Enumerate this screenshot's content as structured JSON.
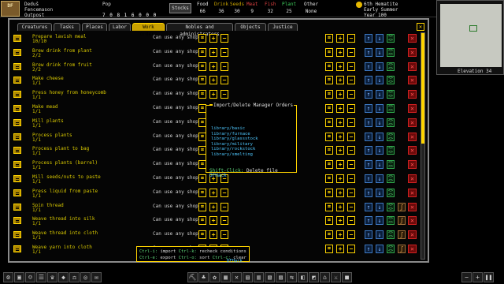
{
  "top": {
    "logo": "DF",
    "fortress": [
      "Deduš",
      "Fencemason",
      "Outpost"
    ],
    "population_header": "Pop",
    "population_values": "7 0 8 1 6 0 0 0",
    "stocks_label": "Stocks",
    "resources": [
      {
        "label": "Food",
        "value": "66",
        "color": "#e0e0e0"
      },
      {
        "label": "Drink",
        "value": "36",
        "color": "#c9a400"
      },
      {
        "label": "Seeds",
        "value": "30",
        "color": "#c9a400"
      },
      {
        "label": "Meat",
        "value": "9",
        "color": "#d84040"
      },
      {
        "label": "Fish",
        "value": "32",
        "color": "#d84040"
      },
      {
        "label": "Plant",
        "value": "25",
        "color": "#3cc85a"
      },
      {
        "label": "Other",
        "value": "None",
        "color": "#e0e0e0"
      }
    ],
    "date": [
      "6th Hematite",
      "Early Summer",
      "Year 100"
    ]
  },
  "tabs": [
    "Creatures",
    "Tasks",
    "Places",
    "Labor",
    "Work orders",
    "Nobles and administrators",
    "Objects",
    "Justice"
  ],
  "active_tab": "Work orders",
  "orders": [
    {
      "name": "Prepare lavish meal",
      "count": "10/10",
      "workshop": "Can use any shop"
    },
    {
      "name": "Brew drink from plant",
      "count": "2/2",
      "workshop": "Can use any shop"
    },
    {
      "name": "Brew drink from fruit",
      "count": "2/2",
      "workshop": "Can use any shop"
    },
    {
      "name": "Make cheese",
      "count": "1/1",
      "workshop": "Can use any shop"
    },
    {
      "name": "Press honey from honeycomb",
      "count": "1/1",
      "workshop": "Can use any shop"
    },
    {
      "name": "Make mead",
      "count": "1/1",
      "workshop": "Can use any shop"
    },
    {
      "name": "Mill plants",
      "count": "1/1",
      "workshop": "Can use any shop"
    },
    {
      "name": "Process plants",
      "count": "1/1",
      "workshop": "Can use any shop"
    },
    {
      "name": "Process plant to bag",
      "count": "1/1",
      "workshop": "Can use any shop"
    },
    {
      "name": "Process plants (barrel)",
      "count": "1/1",
      "workshop": "Can use any shop"
    },
    {
      "name": "Mill seeds/nuts to paste",
      "count": "1/1",
      "workshop": "Can use any shop"
    },
    {
      "name": "Press liquid from paste",
      "count": "1/1",
      "workshop": "Can use any shop"
    },
    {
      "name": "Spin thread",
      "count": "1/1",
      "workshop": "Can use any shop"
    },
    {
      "name": "Weave thread into silk",
      "count": "1/1",
      "workshop": "Can use any shop"
    },
    {
      "name": "Weave thread into cloth",
      "count": "1/1",
      "workshop": "Can use any shop"
    },
    {
      "name": "Weave yarn into cloth",
      "count": "1/1",
      "workshop": "Can use any shop"
    }
  ],
  "dialog": {
    "title": "Import/Delete Manager Orders",
    "files": [
      "library/basic",
      "library/furnace",
      "library/glassstock",
      "library/military",
      "library/rockstock",
      "library/smelting"
    ],
    "footer_key": "Shift-Click:",
    "footer_text": "Delete file",
    "footer_tag": "DFHack"
  },
  "hint": {
    "line1": [
      {
        "k": "Ctrl-i:",
        "t": "import"
      },
      {
        "k": "Ctrl-k:",
        "t": "recheck conditions"
      }
    ],
    "line2": [
      {
        "k": "Ctrl-e:",
        "t": "export"
      },
      {
        "k": "Ctrl-o:",
        "t": "sort"
      },
      {
        "k": "Ctrl-c:",
        "t": "clear"
      }
    ],
    "tag": "DFHack"
  },
  "minimap": {
    "elevation": "Elevation 34"
  }
}
